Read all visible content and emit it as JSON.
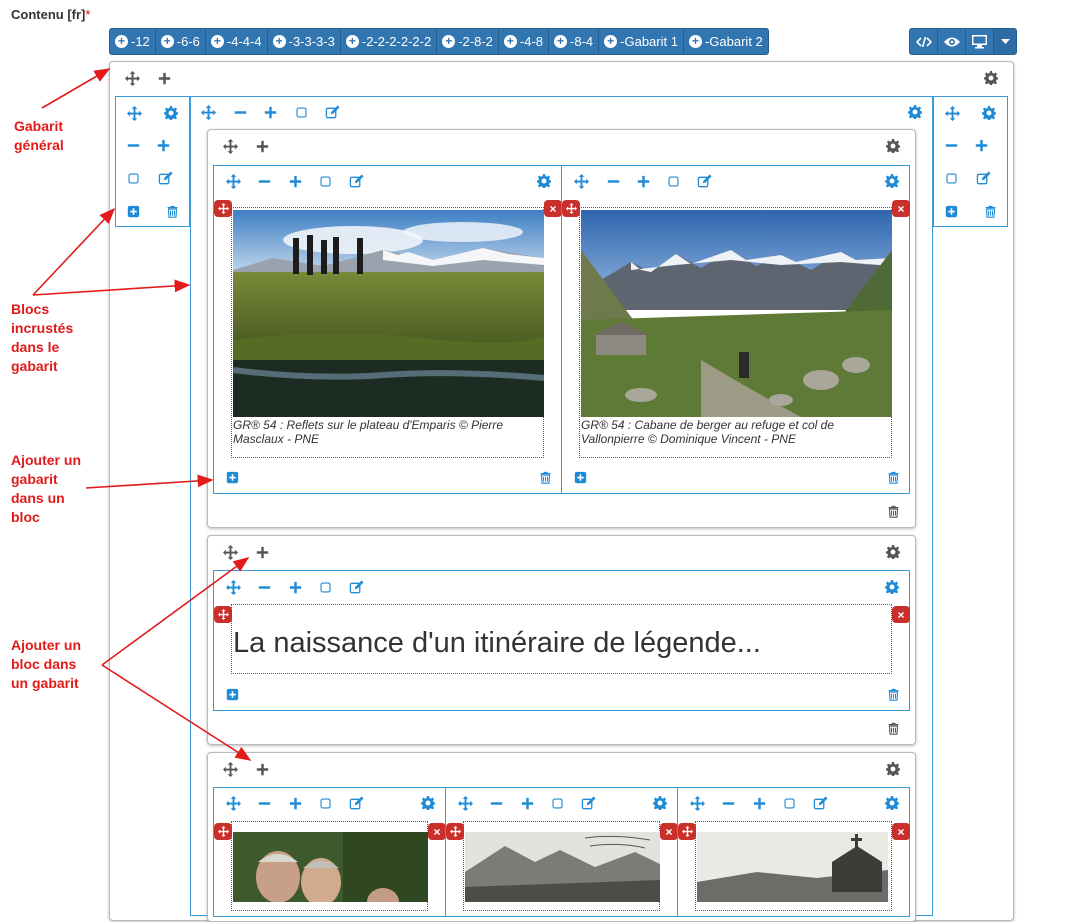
{
  "field_label": "Contenu [fr]",
  "required_mark": "*",
  "toolbar": {
    "buttons": [
      "-12",
      "-6-6",
      "-4-4-4",
      "-3-3-3-3",
      "-2-2-2-2-2-2",
      "-2-8-2",
      "-4-8",
      "-8-4",
      "-Gabarit 1",
      "-Gabarit 2"
    ],
    "right_buttons": [
      "code-icon",
      "eye-icon",
      "desktop-icon",
      "caret-down-icon"
    ]
  },
  "captions": {
    "photo1": "GR® 54 : Reflets sur le plateau d'Emparis © Pierre Masclaux - PNE",
    "photo2": "GR® 54 : Cabane de berger au refuge et col de Vallonpierre © Dominique Vincent - PNE"
  },
  "heading_text": "La naissance d'un itinéraire de légende...",
  "annotations": {
    "gabarit_general": "Gabarit général",
    "blocs_incrustes": "Blocs incrustés dans le gabarit",
    "ajouter_gabarit": "Ajouter un gabarit dans un bloc",
    "ajouter_bloc": "Ajouter un bloc dans un gabarit"
  },
  "colors": {
    "toolbar": "#3276b1",
    "bloc_border": "#3a9ad9",
    "icon_blue": "#1f8ad6",
    "annotation_red": "#e21a1a",
    "delete_red": "#c9302c"
  }
}
